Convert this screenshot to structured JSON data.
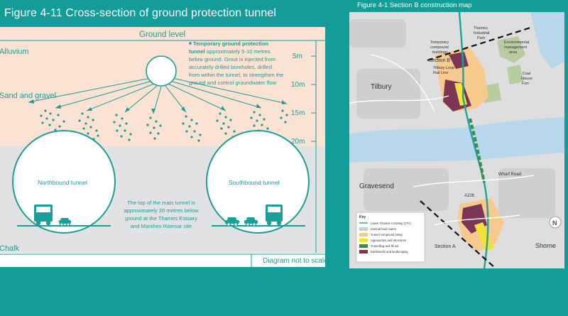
{
  "left_figure": {
    "title": "Figure 4-11 Cross-section of ground protection tunnel",
    "ground_level_label": "Ground level",
    "layers": {
      "alluvium": "Alluvium",
      "sand_gravel": "Sand and gravel",
      "chalk": "Chalk"
    },
    "depth_scale": [
      "5m",
      "10m",
      "15m",
      "20m"
    ],
    "callout": {
      "bold_line1": "Temporary ground protection",
      "bold_line2": "tunnel",
      "line2_rest": " approximately 5-10 metres",
      "line3": "below ground. Grout is injected from",
      "line4": "accurately drilled boreholes, drilled",
      "line5": "from within the tunnel, to strengthen the",
      "line6": "ground and control groundwater flow"
    },
    "northbound_label": "Northbound tunnel",
    "southbound_label": "Southbound tunnel",
    "main_tunnel_note": {
      "line1": "The top of the main tunnel is",
      "line2": "approximately 20 metres below",
      "line3": "ground at the Thames Estuary",
      "line4": "and Marshes Ramsar site"
    },
    "footer": "Diagram not to scale",
    "colors": {
      "teal": "#1a9e98",
      "alluvium_fill": "#fbe2d2",
      "chalk_fill": "#e1e2e3"
    }
  },
  "right_figure": {
    "title": "Figure 4-1 Section B construction map",
    "labels": {
      "thames_industrial_park": [
        "Thames",
        "Industrial",
        "Park"
      ],
      "temporary_compound": [
        "Temporary",
        "compound",
        "buildings"
      ],
      "environmental_area": [
        "Environmental",
        "management",
        "area"
      ],
      "section_b": "Section B",
      "tilbury_loop": [
        "Tilbury Loop",
        "Rail Line"
      ],
      "coalhouse_fort": [
        "Coal",
        "House",
        "Fort"
      ],
      "tilbury": "Tilbury",
      "wharf_road": "Wharf Road",
      "gravesend": "Gravesend",
      "a226": "A226",
      "section_a": "Section A",
      "shorne": "Shorne",
      "north_arrow": "N"
    },
    "key": {
      "title": "Key",
      "items": [
        {
          "label": "Lower Thames Crossing (LTC)",
          "color": "#1aa39c"
        },
        {
          "label": "Internal haul routes",
          "color": "#cfcfcf"
        },
        {
          "label": "Tunnel compound setup",
          "color": "#f6c98d"
        },
        {
          "label": "Approaches and structures",
          "color": "#f1e23a"
        },
        {
          "label": "Tunnelling and fill out",
          "color": "#3f8a4a"
        },
        {
          "label": "Earthworks and landscaping",
          "color": "#7d3556"
        }
      ]
    }
  }
}
